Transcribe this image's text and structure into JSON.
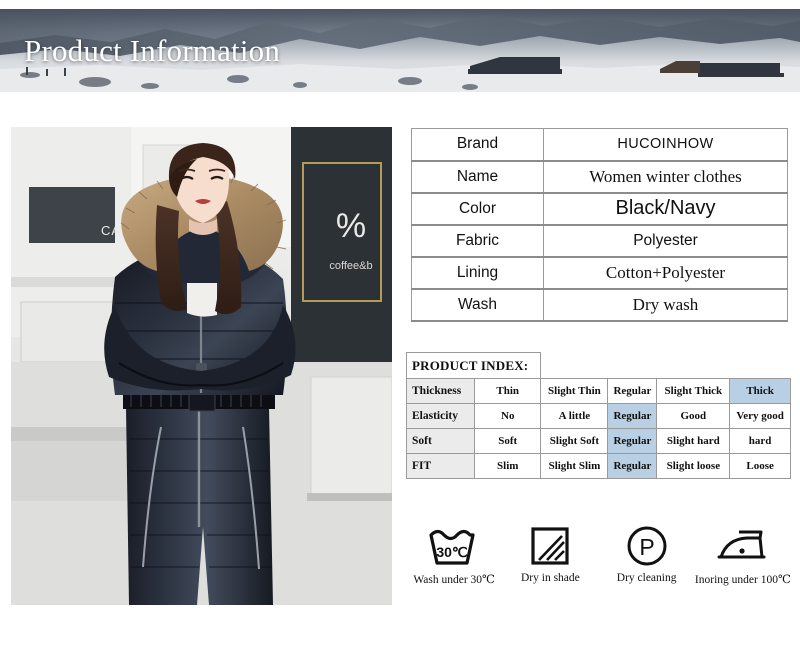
{
  "banner": {
    "title": "Product Information",
    "image_alt": "snowy-mountain-landscape-with-huts"
  },
  "product_photo": {
    "alt": "model-wearing-black-hooded-fur-trim-puffer-snowsuit",
    "storefront_logo": "%",
    "storefront_text": "coffee&b"
  },
  "spec": {
    "rows": [
      {
        "key": "Brand",
        "value": "HUCOINHOW",
        "style": "sans"
      },
      {
        "key": "Name",
        "value": "Women winter clothes",
        "style": "serif"
      },
      {
        "key": "Color",
        "value": "Black/Navy",
        "style": "big"
      },
      {
        "key": "Fabric",
        "value": "Polyester",
        "style": "mid"
      },
      {
        "key": "Lining",
        "value": "Cotton+Polyester",
        "style": "serif"
      },
      {
        "key": "Wash",
        "value": "Dry wash",
        "style": "serif"
      }
    ]
  },
  "index": {
    "title": "PRODUCT INDEX:",
    "rows": [
      {
        "label": "Thickness",
        "cells": [
          "Thin",
          "Slight Thin",
          "Regular",
          "Slight Thick",
          "Thick"
        ],
        "highlight": 4
      },
      {
        "label": "Elasticity",
        "cells": [
          "No",
          "A little",
          "Regular",
          "Good",
          "Very good"
        ],
        "highlight": 2
      },
      {
        "label": "Soft",
        "cells": [
          "Soft",
          "Slight Soft",
          "Regular",
          "Slight hard",
          "hard"
        ],
        "highlight": 2
      },
      {
        "label": "FIT",
        "cells": [
          "Slim",
          "Slight Slim",
          "Regular",
          "Slight loose",
          "Loose"
        ],
        "highlight": 2
      }
    ],
    "highlight_color": "#b9cfe4",
    "label_color": "#ebebeb"
  },
  "care": [
    {
      "icon": "wash-tub-icon",
      "temp": "30℃",
      "label": "Wash under 30℃"
    },
    {
      "icon": "dry-in-shade-icon",
      "temp": "",
      "label": "Dry in shade"
    },
    {
      "icon": "dry-cleaning-icon",
      "temp": "P",
      "label": "Dry cleaning"
    },
    {
      "icon": "iron-icon",
      "temp": "",
      "label": "Inoring under 100℃"
    }
  ]
}
